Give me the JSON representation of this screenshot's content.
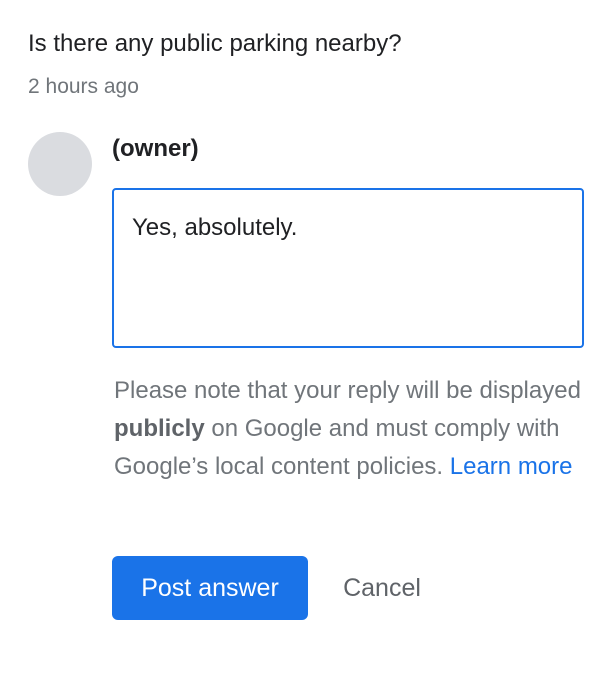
{
  "question": {
    "text": "Is there any public parking nearby?",
    "timestamp": "2 hours ago"
  },
  "reply": {
    "author": "(owner)",
    "value": "Yes, absolutely.",
    "notice": {
      "prefix": "Please note that your reply will be displayed ",
      "bold": "publicly",
      "suffix": " on Google and must comply with Google’s local content policies. ",
      "link": "Learn more"
    }
  },
  "actions": {
    "post_label": "Post answer",
    "cancel_label": "Cancel"
  },
  "colors": {
    "accent": "#1a73e8",
    "avatar": "#dadce0",
    "secondary_text": "#70757a"
  }
}
